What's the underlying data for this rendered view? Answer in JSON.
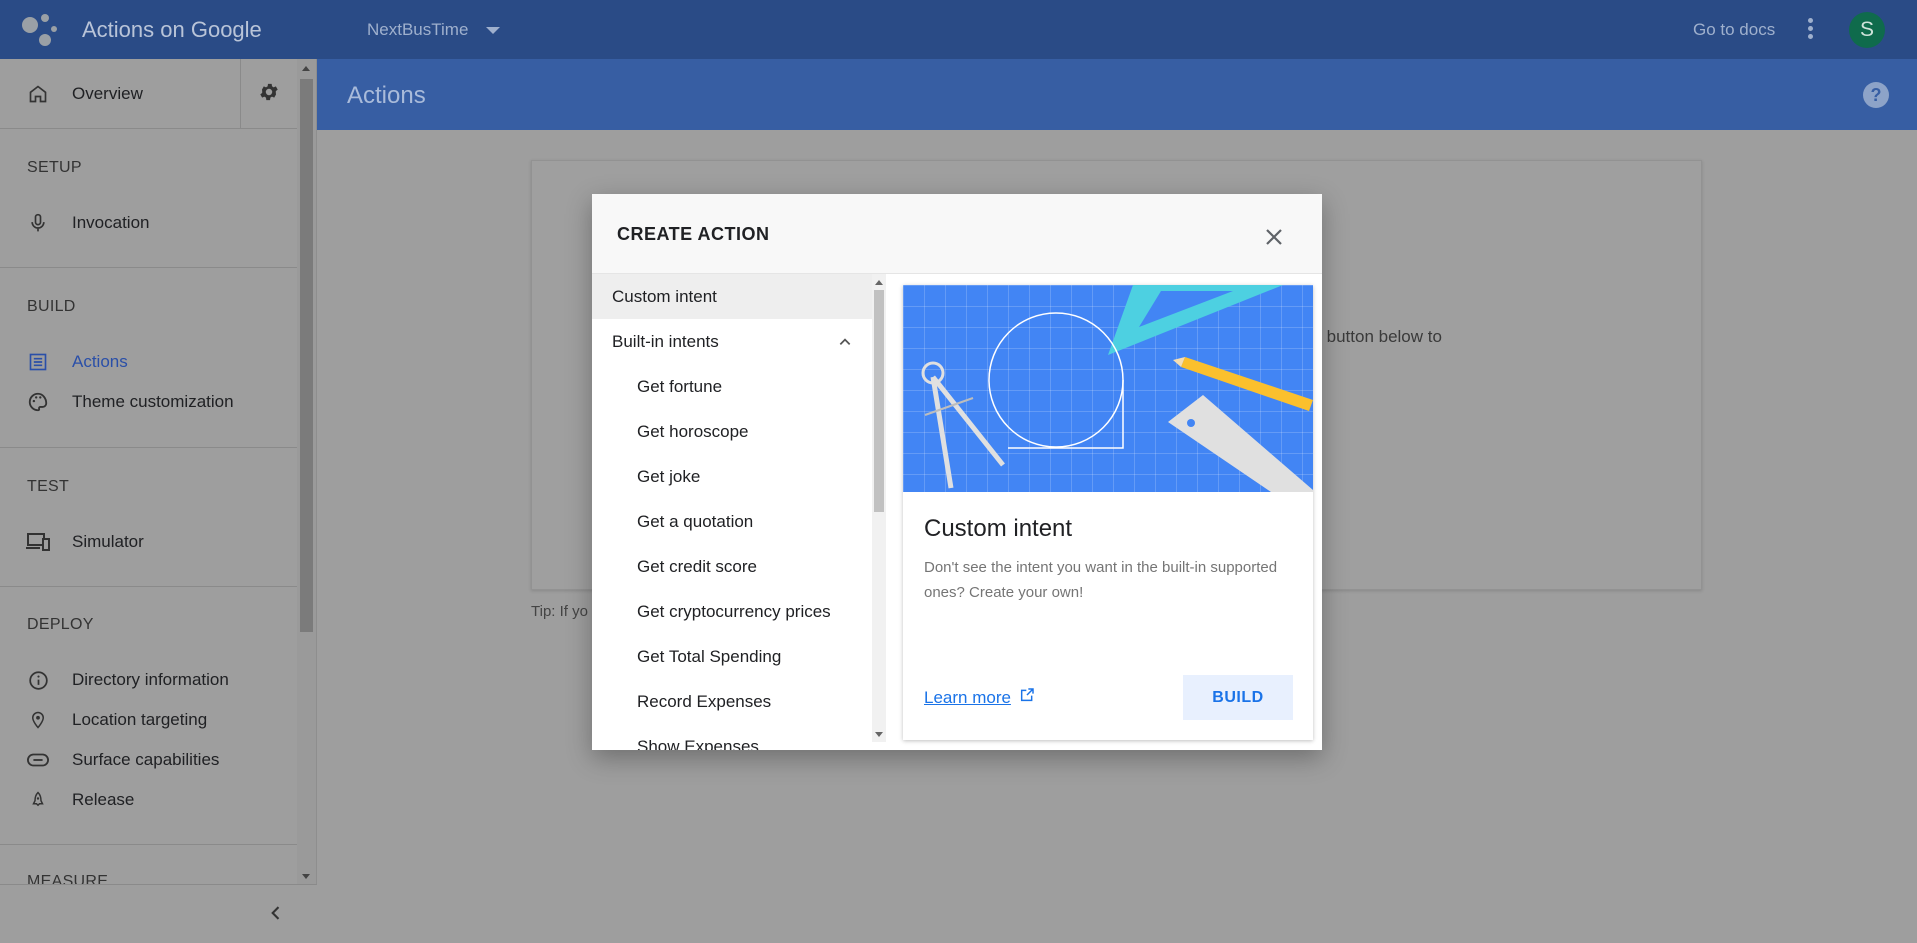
{
  "appbar": {
    "title": "Actions on Google",
    "project": "NextBusTime",
    "docs_link": "Go to docs",
    "avatar_letter": "S"
  },
  "sidebar": {
    "overview": "Overview",
    "sections": [
      {
        "title": "SETUP",
        "items": [
          {
            "label": "Invocation",
            "icon": "microphone-icon"
          }
        ]
      },
      {
        "title": "BUILD",
        "items": [
          {
            "label": "Actions",
            "icon": "list-icon",
            "active": true
          },
          {
            "label": "Theme customization",
            "icon": "palette-icon"
          }
        ]
      },
      {
        "title": "TEST",
        "items": [
          {
            "label": "Simulator",
            "icon": "devices-icon"
          }
        ]
      },
      {
        "title": "DEPLOY",
        "items": [
          {
            "label": "Directory information",
            "icon": "info-icon"
          },
          {
            "label": "Location targeting",
            "icon": "location-pin-icon"
          },
          {
            "label": "Surface capabilities",
            "icon": "toggle-icon"
          },
          {
            "label": "Release",
            "icon": "rocket-icon"
          }
        ]
      },
      {
        "title": "MEASURE",
        "items": []
      }
    ]
  },
  "page": {
    "title": "Actions",
    "background_text_fragment": "he button below to",
    "tip_fragment": "Tip: If yo"
  },
  "dialog": {
    "title": "CREATE ACTION",
    "list": {
      "custom_intent": "Custom intent",
      "builtin_header": "Built-in intents",
      "builtin_items": [
        "Get fortune",
        "Get horoscope",
        "Get joke",
        "Get a quotation",
        "Get credit score",
        "Get cryptocurrency prices",
        "Get Total Spending",
        "Record Expenses",
        "Show Expenses"
      ]
    },
    "detail": {
      "title": "Custom intent",
      "description": "Don't see the intent you want in the built-in supported ones? Create your own!",
      "learn_more": "Learn more",
      "build_button": "BUILD"
    }
  },
  "colors": {
    "appbar": "#2a4b86",
    "page_header": "#375ea3",
    "accent_blue": "#1a73e8",
    "hero_blue": "#4285f4",
    "avatar_green": "#0f6b4c"
  }
}
